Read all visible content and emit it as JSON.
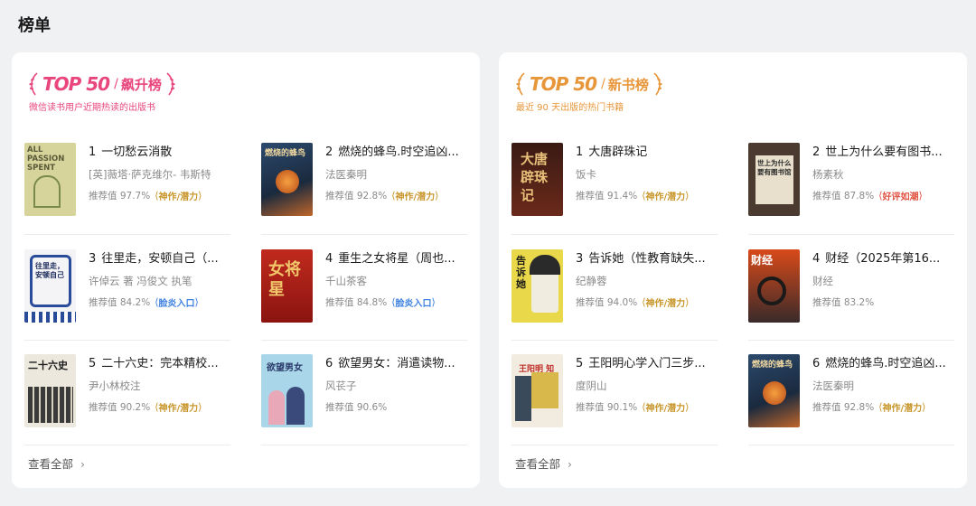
{
  "page": {
    "title": "榜单"
  },
  "panels": [
    {
      "badge": "TOP 50",
      "name": "飙升榜",
      "subtitle": "微信读书用户近期热读的出版书",
      "view_all": "查看全部",
      "items": [
        {
          "rank": "1",
          "title": "一切愁云消散",
          "author": "[英]薇塔·萨克维尔- 韦斯特",
          "score": "推荐值 97.7%",
          "tag": "神作/潜力",
          "tag_color": "gold",
          "cover_text": "ALL PASSION SPENT"
        },
        {
          "rank": "2",
          "title": "燃烧的蜂鸟.时空追凶...",
          "author": "法医秦明",
          "score": "推荐值 92.8%",
          "tag": "神作/潜力",
          "tag_color": "gold",
          "cover_text": "燃烧的蜂鸟"
        },
        {
          "rank": "3",
          "title": "往里走，安顿自己（...",
          "author": "许倬云 著 冯俊文 执笔",
          "score": "推荐值 84.2%",
          "tag": "脸炎入口",
          "tag_color": "blue",
          "cover_text": "往里走，安顿自己"
        },
        {
          "rank": "4",
          "title": "重生之女将星（周也...",
          "author": "千山茶客",
          "score": "推荐值 84.8%",
          "tag": "脸炎入口",
          "tag_color": "blue",
          "cover_text": "女将星"
        },
        {
          "rank": "5",
          "title": "二十六史：完本精校...",
          "author": "尹小林校注",
          "score": "推荐值 90.2%",
          "tag": "神作/潜力",
          "tag_color": "gold",
          "cover_text": "二十六史"
        },
        {
          "rank": "6",
          "title": "欲望男女：消遣读物...",
          "author": "风苌子",
          "score": "推荐值 90.6%",
          "tag": "",
          "tag_color": "",
          "cover_text": "欲望男女"
        }
      ]
    },
    {
      "badge": "TOP 50",
      "name": "新书榜",
      "subtitle": "最近 90 天出版的热门书籍",
      "view_all": "查看全部",
      "items": [
        {
          "rank": "1",
          "title": "大唐辟珠记",
          "author": "饭卡",
          "score": "推荐值 91.4%",
          "tag": "神作/潜力",
          "tag_color": "gold",
          "cover_text": "大唐辟珠记"
        },
        {
          "rank": "2",
          "title": "世上为什么要有图书...",
          "author": "杨素秋",
          "score": "推荐值 87.8%",
          "tag": "好评如潮",
          "tag_color": "red",
          "cover_text": "世上为什么要有图书馆"
        },
        {
          "rank": "3",
          "title": "告诉她（性教育缺失...",
          "author": "纪静蓉",
          "score": "推荐值 94.0%",
          "tag": "神作/潜力",
          "tag_color": "gold",
          "cover_text": "告诉她"
        },
        {
          "rank": "4",
          "title": "财经（2025年第16...",
          "author": "财经",
          "score": "推荐值 83.2%",
          "tag": "",
          "tag_color": "",
          "cover_text": "财经"
        },
        {
          "rank": "5",
          "title": "王阳明心学入门三步...",
          "author": "度阴山",
          "score": "推荐值 90.1%",
          "tag": "神作/潜力",
          "tag_color": "gold",
          "cover_text": "王阳明 知行合一"
        },
        {
          "rank": "6",
          "title": "燃烧的蜂鸟.时空追凶...",
          "author": "法医秦明",
          "score": "推荐值 92.8%",
          "tag": "神作/潜力",
          "tag_color": "gold",
          "cover_text": "燃烧的蜂鸟"
        }
      ]
    }
  ]
}
